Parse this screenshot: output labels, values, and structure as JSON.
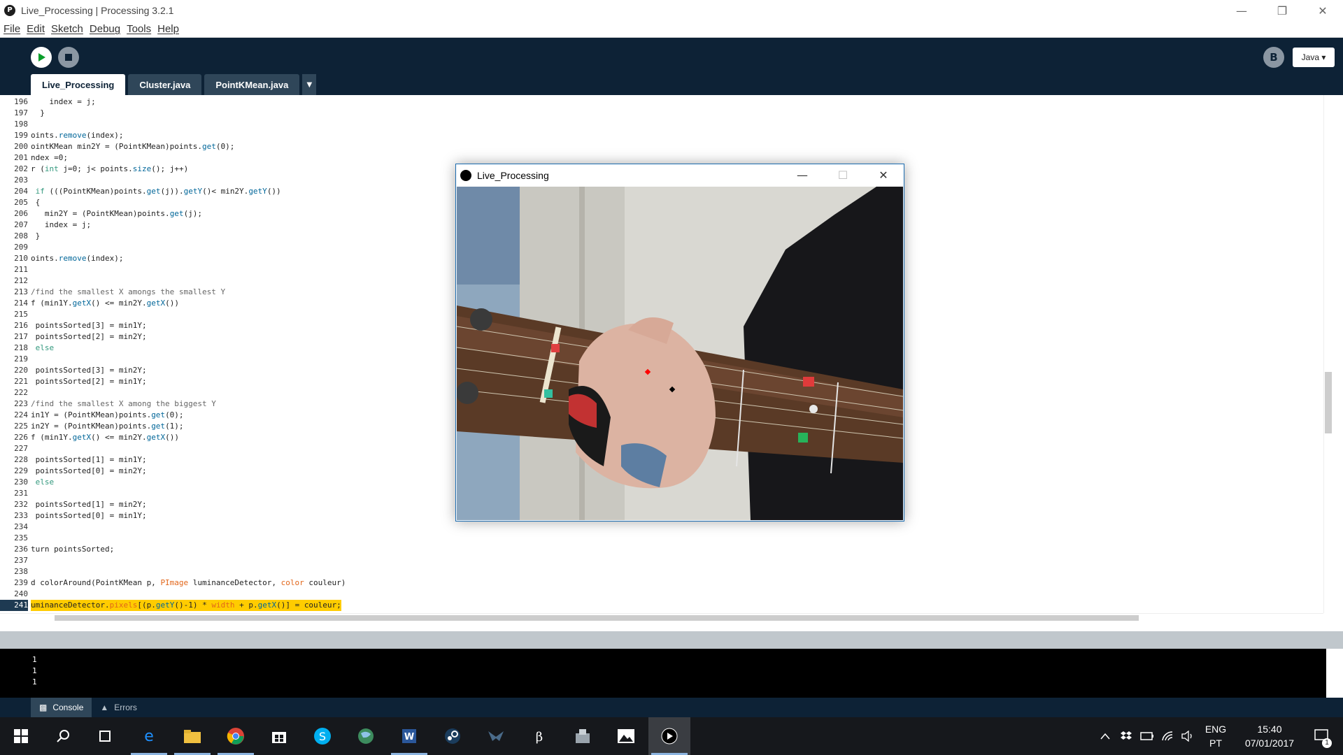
{
  "window": {
    "title": "Live_Processing | Processing 3.2.1",
    "logo_letter": "P"
  },
  "menu": [
    "File",
    "Edit",
    "Sketch",
    "Debug",
    "Tools",
    "Help"
  ],
  "toolbar": {
    "mode": "Java ▾",
    "debug_glyph": "B"
  },
  "tabs": [
    {
      "label": "Live_Processing",
      "active": true
    },
    {
      "label": "Cluster.java",
      "active": false
    },
    {
      "label": "PointKMean.java",
      "active": false
    }
  ],
  "tab_menu_glyph": "▼",
  "code": {
    "highlighted_line": 241,
    "lines": [
      {
        "n": 196,
        "t": "    index = j;"
      },
      {
        "n": 197,
        "t": "  }"
      },
      {
        "n": 198,
        "t": ""
      },
      {
        "n": 199,
        "t": "oints.remove(index);"
      },
      {
        "n": 200,
        "t": "ointKMean min2Y = (PointKMean)points.get(0);"
      },
      {
        "n": 201,
        "t": "ndex =0;"
      },
      {
        "n": 202,
        "t": "r (int j=0; j< points.size(); j++)"
      },
      {
        "n": 203,
        "t": ""
      },
      {
        "n": 204,
        "t": " if (((PointKMean)points.get(j)).getY()< min2Y.getY())"
      },
      {
        "n": 205,
        "t": " {"
      },
      {
        "n": 206,
        "t": "   min2Y = (PointKMean)points.get(j);"
      },
      {
        "n": 207,
        "t": "   index = j;"
      },
      {
        "n": 208,
        "t": " }"
      },
      {
        "n": 209,
        "t": ""
      },
      {
        "n": 210,
        "t": "oints.remove(index);"
      },
      {
        "n": 211,
        "t": ""
      },
      {
        "n": 212,
        "t": ""
      },
      {
        "n": 213,
        "t": "/find the smallest X amongs the smallest Y"
      },
      {
        "n": 214,
        "t": "f (min1Y.getX() <= min2Y.getX())"
      },
      {
        "n": 215,
        "t": ""
      },
      {
        "n": 216,
        "t": " pointsSorted[3] = min1Y;"
      },
      {
        "n": 217,
        "t": " pointsSorted[2] = min2Y;"
      },
      {
        "n": 218,
        "t": " else"
      },
      {
        "n": 219,
        "t": ""
      },
      {
        "n": 220,
        "t": " pointsSorted[3] = min2Y;"
      },
      {
        "n": 221,
        "t": " pointsSorted[2] = min1Y;"
      },
      {
        "n": 222,
        "t": ""
      },
      {
        "n": 223,
        "t": "/find the smallest X among the biggest Y"
      },
      {
        "n": 224,
        "t": "in1Y = (PointKMean)points.get(0);"
      },
      {
        "n": 225,
        "t": "in2Y = (PointKMean)points.get(1);"
      },
      {
        "n": 226,
        "t": "f (min1Y.getX() <= min2Y.getX())"
      },
      {
        "n": 227,
        "t": ""
      },
      {
        "n": 228,
        "t": " pointsSorted[1] = min1Y;"
      },
      {
        "n": 229,
        "t": " pointsSorted[0] = min2Y;"
      },
      {
        "n": 230,
        "t": " else"
      },
      {
        "n": 231,
        "t": ""
      },
      {
        "n": 232,
        "t": " pointsSorted[1] = min2Y;"
      },
      {
        "n": 233,
        "t": " pointsSorted[0] = min1Y;"
      },
      {
        "n": 234,
        "t": ""
      },
      {
        "n": 235,
        "t": ""
      },
      {
        "n": 236,
        "t": "turn pointsSorted;"
      },
      {
        "n": 237,
        "t": ""
      },
      {
        "n": 238,
        "t": ""
      },
      {
        "n": 239,
        "t": "d colorAround(PointKMean p, PImage luminanceDetector, color couleur)"
      },
      {
        "n": 240,
        "t": ""
      },
      {
        "n": 241,
        "t": "uminanceDetector.pixels[(p.getY()-1) * width + p.getX()] = couleur;"
      }
    ]
  },
  "console": {
    "lines": [
      "1",
      "1",
      "1"
    ]
  },
  "console_tabs": [
    {
      "label": "Console",
      "icon": "console-icon",
      "active": true
    },
    {
      "label": "Errors",
      "icon": "warning-icon",
      "active": false
    }
  ],
  "sketch_window": {
    "title": "Live_Processing"
  },
  "taskbar": {
    "lang_line1": "ENG",
    "lang_line2": "PT",
    "time": "15:40",
    "date": "07/01/2017",
    "notification_count": "1"
  }
}
